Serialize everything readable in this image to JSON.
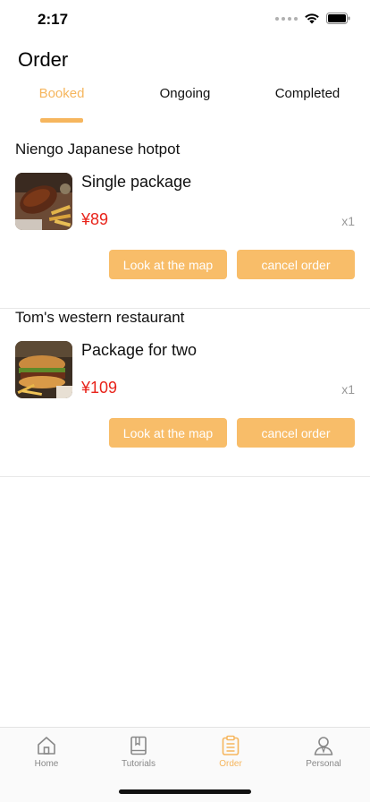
{
  "status_bar": {
    "time": "2:17"
  },
  "page": {
    "title": "Order"
  },
  "tabs": [
    {
      "label": "Booked",
      "active": true
    },
    {
      "label": "Ongoing",
      "active": false
    },
    {
      "label": "Completed",
      "active": false
    }
  ],
  "orders": [
    {
      "restaurant": "Niengo Japanese hotpot",
      "package": "Single package",
      "price": "¥89",
      "quantity": "x1",
      "map_button": "Look at the map",
      "cancel_button": "cancel order"
    },
    {
      "restaurant": "Tom's western restaurant",
      "package": "Package for two",
      "price": "¥109",
      "quantity": "x1",
      "map_button": "Look at the map",
      "cancel_button": "cancel order"
    }
  ],
  "tabbar": [
    {
      "label": "Home",
      "icon": "home-icon",
      "active": false
    },
    {
      "label": "Tutorials",
      "icon": "book-icon",
      "active": false
    },
    {
      "label": "Order",
      "icon": "clipboard-icon",
      "active": true
    },
    {
      "label": "Personal",
      "icon": "person-icon",
      "active": false
    }
  ],
  "colors": {
    "accent": "#f6b65e",
    "button": "#f8bd69",
    "price": "#e8231a"
  }
}
